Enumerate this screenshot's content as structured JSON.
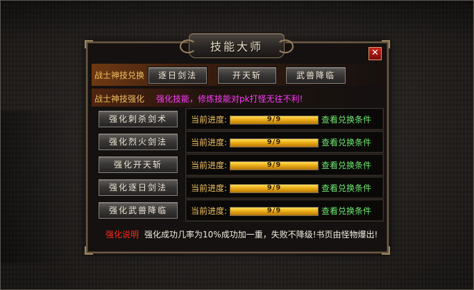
{
  "dialog": {
    "title": "技能大师",
    "close_icon": "close-icon"
  },
  "exchange": {
    "label": "战士神技兑换",
    "buttons": [
      "逐日剑法",
      "开天斩",
      "武兽降临"
    ]
  },
  "strengthen": {
    "label": "战士神技强化",
    "note": "强化技能，修炼技能对pk打怪无往不利!"
  },
  "skills": [
    {
      "button": "强化刺杀剑术",
      "progress_label": "当前进度:",
      "progress_text": "9/9",
      "progress_fraction": 1.0,
      "link": "查看兑换条件"
    },
    {
      "button": "强化烈火剑法",
      "progress_label": "当前进度:",
      "progress_text": "9/9",
      "progress_fraction": 1.0,
      "link": "查看兑换条件"
    },
    {
      "button": "强化开天斩",
      "progress_label": "当前进度:",
      "progress_text": "9/9",
      "progress_fraction": 1.0,
      "link": "查看兑换条件"
    },
    {
      "button": "强化逐日剑法",
      "progress_label": "当前进度:",
      "progress_text": "9/9",
      "progress_fraction": 1.0,
      "link": "查看兑换条件"
    },
    {
      "button": "强化武兽降临",
      "progress_label": "当前进度:",
      "progress_text": "9/9",
      "progress_fraction": 1.0,
      "link": "查看兑换条件"
    }
  ],
  "footer": {
    "heading": "强化说明",
    "text": "强化成功几率为10%成功加一重，失败不降级!书页由怪物爆出!"
  },
  "colors": {
    "label_orange": "#f0c060",
    "note_magenta": "#ff3cff",
    "link_green": "#6ee86e",
    "footer_red": "#ff2a1a",
    "bar_gold": "#e8a915"
  }
}
